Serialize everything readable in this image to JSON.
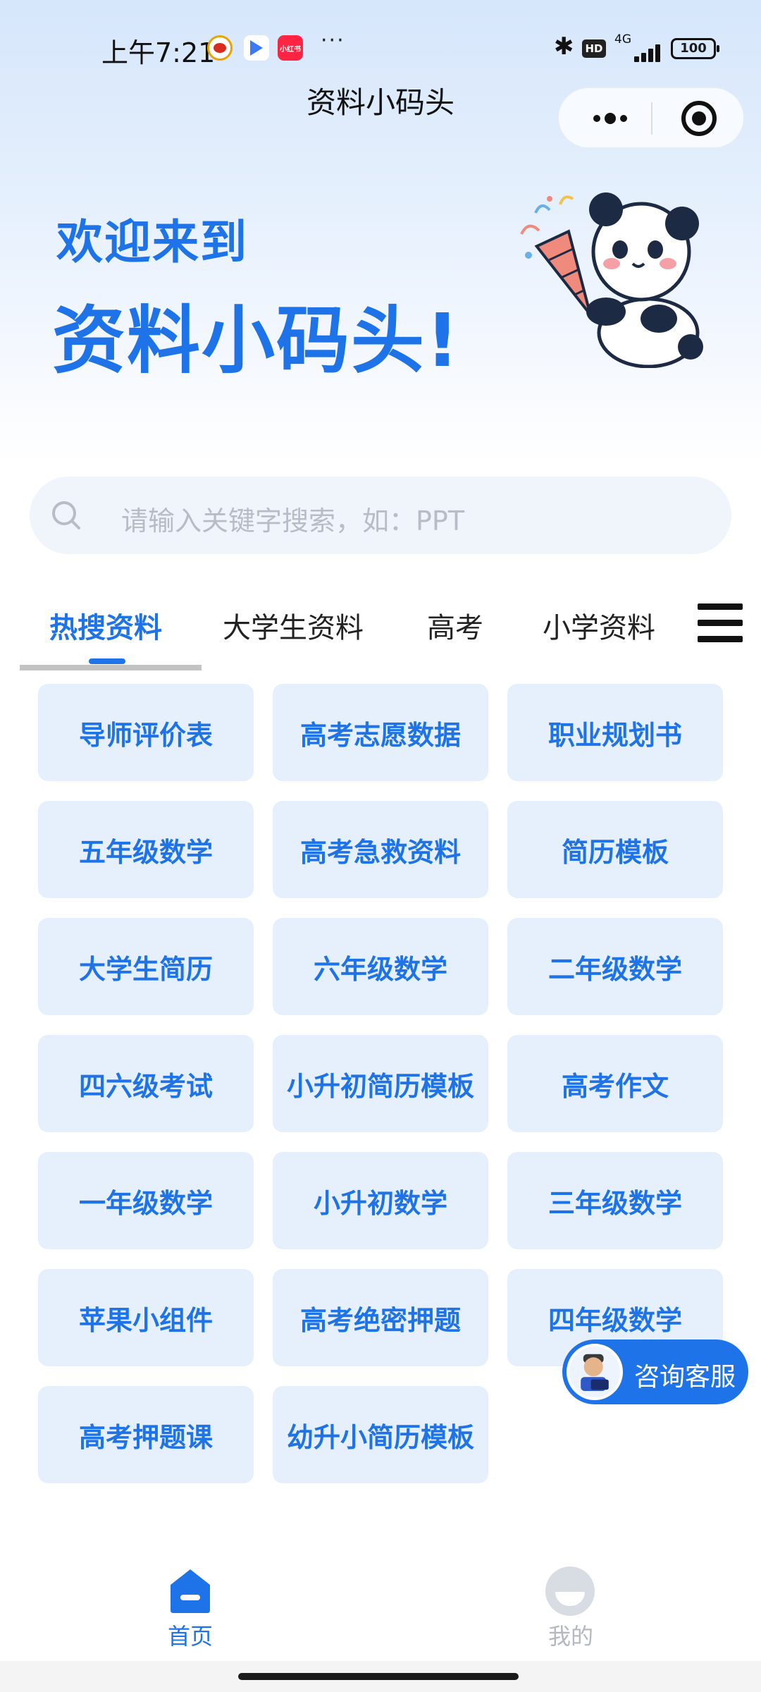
{
  "status_bar": {
    "time": "上午7:21",
    "more": "···",
    "hd": "HD",
    "network": "4G",
    "battery": "100"
  },
  "nav": {
    "title": "资料小码头"
  },
  "hero": {
    "line1": "欢迎来到",
    "line2": "资料小码头!"
  },
  "search": {
    "placeholder": "请输入关键字搜索，如：PPT"
  },
  "tabs": [
    {
      "label": "热搜资料",
      "active": true
    },
    {
      "label": "大学生资料",
      "active": false
    },
    {
      "label": "高考",
      "active": false
    },
    {
      "label": "小学资料",
      "active": false
    }
  ],
  "items": [
    "导师评价表",
    "高考志愿数据",
    "职业规划书",
    "五年级数学",
    "高考急救资料",
    "简历模板",
    "大学生简历",
    "六年级数学",
    "二年级数学",
    "四六级考试",
    "小升初简历模板",
    "高考作文",
    "一年级数学",
    "小升初数学",
    "三年级数学",
    "苹果小组件",
    "高考绝密押题",
    "四年级数学",
    "高考押题课",
    "幼升小简历模板"
  ],
  "service": {
    "label": "咨询客服"
  },
  "bottom_nav": {
    "home": "首页",
    "mine": "我的"
  },
  "colors": {
    "accent": "#1e73e8",
    "tile_bg": "#e6f0fd"
  }
}
